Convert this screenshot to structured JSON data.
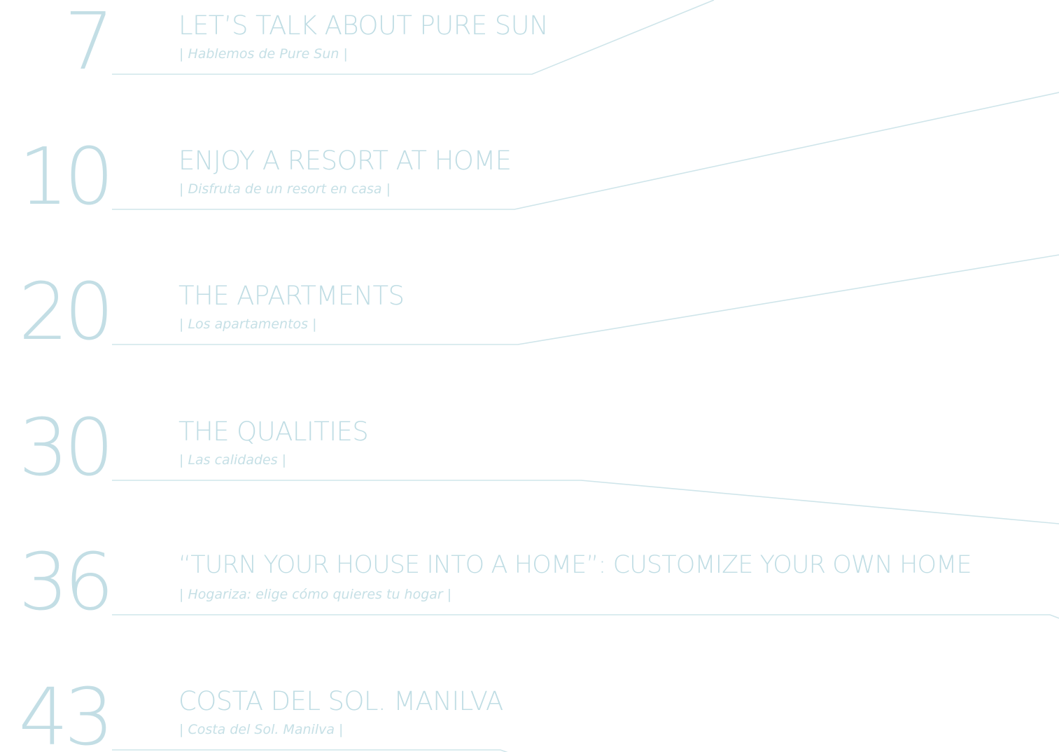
{
  "accent_color": "#c3dee5",
  "toc": [
    {
      "page": "7",
      "title": "LET’S TALK ABOUT PURE SUN",
      "subtitle": "| Hablemos de Pure Sun |"
    },
    {
      "page": "10",
      "title": "ENJOY A RESORT AT HOME",
      "subtitle": "| Disfruta de un resort en casa |"
    },
    {
      "page": "20",
      "title": "THE APARTMENTS",
      "subtitle": "| Los apartamentos |"
    },
    {
      "page": "30",
      "title": "THE QUALITIES",
      "subtitle": "| Las calidades |"
    },
    {
      "page": "36",
      "title": "“TURN YOUR HOUSE INTO A HOME”: CUSTOMIZE YOUR OWN HOME",
      "subtitle": "| Hogariza: elige cómo quieres tu hogar |"
    },
    {
      "page": "43",
      "title": "COSTA DEL SOL. MANILVA",
      "subtitle": "| Costa del Sol. Manilva |"
    }
  ]
}
